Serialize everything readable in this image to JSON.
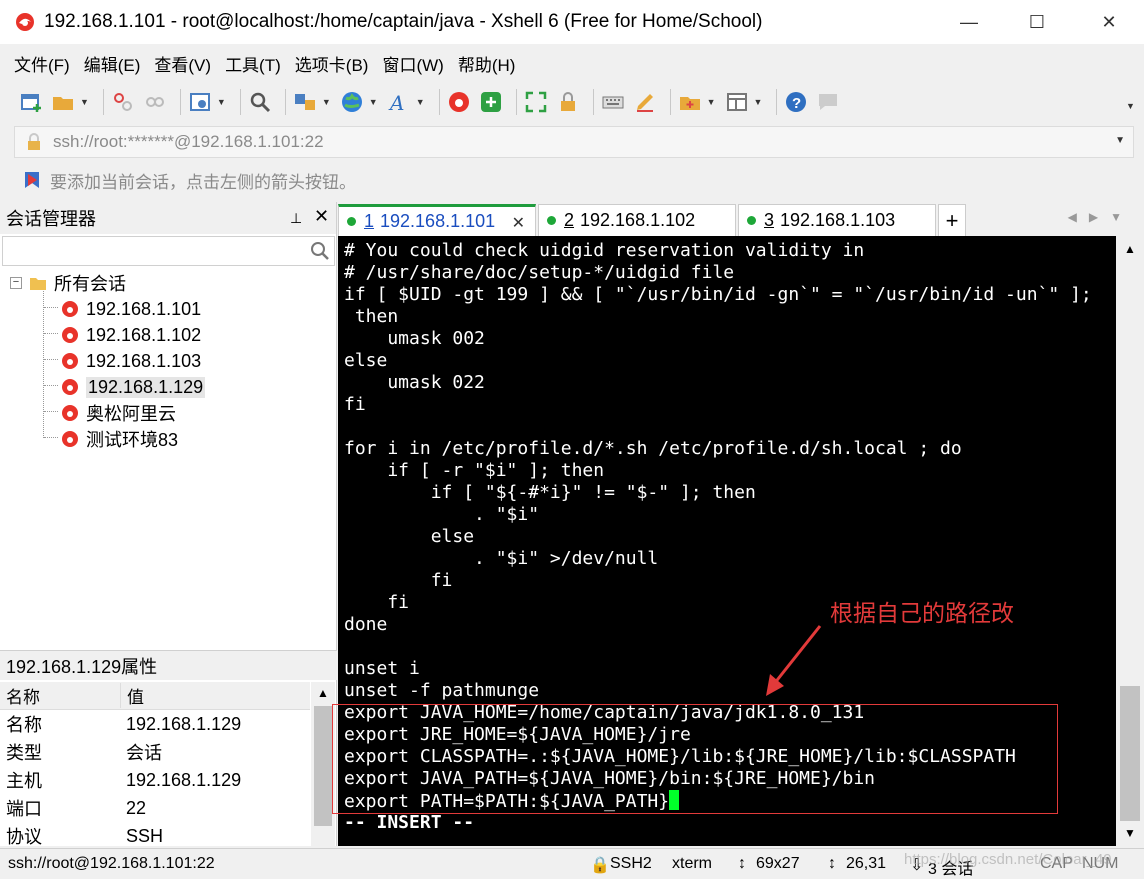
{
  "window": {
    "title": "192.168.1.101 - root@localhost:/home/captain/java - Xshell 6 (Free for Home/School)",
    "min": "—",
    "max": "☐",
    "close": "✕"
  },
  "menu": [
    "文件(F)",
    "编辑(E)",
    "查看(V)",
    "工具(T)",
    "选项卡(B)",
    "窗口(W)",
    "帮助(H)"
  ],
  "address": {
    "text": "ssh://root:*******@192.168.1.101:22"
  },
  "hint": {
    "text": "要添加当前会话，点击左侧的箭头按钮。"
  },
  "session_manager": {
    "title": "会话管理器",
    "pin": "⊥",
    "close": "✕",
    "root": "所有会话",
    "items": [
      "192.168.1.101",
      "192.168.1.102",
      "192.168.1.103",
      "192.168.1.129",
      "奥松阿里云",
      "测试环境83"
    ],
    "selected_index": 3
  },
  "properties": {
    "title": "192.168.1.129属性",
    "col_name": "名称",
    "col_value": "值",
    "rows": [
      {
        "k": "名称",
        "v": "192.168.1.129"
      },
      {
        "k": "类型",
        "v": "会话"
      },
      {
        "k": "主机",
        "v": "192.168.1.129"
      },
      {
        "k": "端口",
        "v": "22"
      },
      {
        "k": "协议",
        "v": "SSH"
      }
    ]
  },
  "tabs": [
    {
      "num": "1",
      "label": "192.168.1.101",
      "active": true
    },
    {
      "num": "2",
      "label": "192.168.1.102",
      "active": false
    },
    {
      "num": "3",
      "label": "192.168.1.103",
      "active": false
    }
  ],
  "tab_add": "+",
  "terminal": {
    "lines": [
      "# You could check uidgid reservation validity in",
      "# /usr/share/doc/setup-*/uidgid file",
      "if [ $UID -gt 199 ] && [ \"`/usr/bin/id -gn`\" = \"`/usr/bin/id -un`\" ];",
      " then",
      "    umask 002",
      "else",
      "    umask 022",
      "fi",
      "",
      "for i in /etc/profile.d/*.sh /etc/profile.d/sh.local ; do",
      "    if [ -r \"$i\" ]; then",
      "        if [ \"${-#*i}\" != \"$-\" ]; then",
      "            . \"$i\"",
      "        else",
      "            . \"$i\" >/dev/null",
      "        fi",
      "    fi",
      "done",
      "",
      "unset i",
      "unset -f pathmunge",
      "export JAVA_HOME=/home/captain/java/jdk1.8.0_131",
      "export JRE_HOME=${JAVA_HOME}/jre",
      "export CLASSPATH=.:${JAVA_HOME}/lib:${JRE_HOME}/lib:$CLASSPATH",
      "export JAVA_PATH=${JAVA_HOME}/bin:${JRE_HOME}/bin",
      "export PATH=$PATH:${JAVA_PATH}",
      "-- INSERT --"
    ]
  },
  "annotation": {
    "text": "根据自己的路径改",
    "color": "#e23a3a"
  },
  "status": {
    "address": "ssh://root@192.168.1.101:22",
    "protocol": "SSH2",
    "term": "xterm",
    "size": "69x27",
    "pos": "26,31",
    "sessions": "3 会话",
    "caps": "CAP",
    "num": "NUM"
  },
  "watermark": "https://blog.csdn.net/Coloar_49",
  "colors": {
    "accent_green": "#1ea738",
    "terminal_bg": "#000000",
    "cursor": "#00ff2a"
  }
}
